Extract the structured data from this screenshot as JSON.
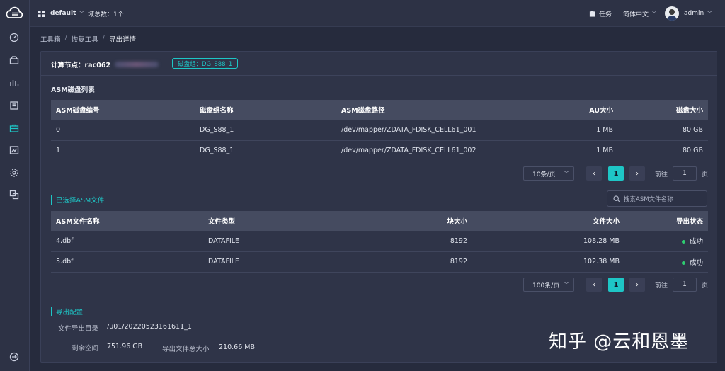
{
  "topbar": {
    "workspace": "default",
    "domain_count": "域总数：1个",
    "tasks": "任务",
    "language": "简体中文",
    "user": "admin"
  },
  "breadcrumb": [
    "工具箱",
    "恢复工具",
    "导出详情"
  ],
  "node": {
    "label": "计算节点：rac062",
    "diskgroup_tag": "磁盘组：DG_S88_1"
  },
  "asm_disks": {
    "title": "ASM磁盘列表",
    "headers": [
      "ASM磁盘编号",
      "磁盘组名称",
      "ASM磁盘路径",
      "AU大小",
      "磁盘大小"
    ],
    "rows": [
      [
        "0",
        "DG_S88_1",
        "/dev/mapper/ZDATA_FDISK_CELL61_001",
        "1 MB",
        "80 GB"
      ],
      [
        "1",
        "DG_S88_1",
        "/dev/mapper/ZDATA_FDISK_CELL61_002",
        "1 MB",
        "80 GB"
      ]
    ],
    "pager": {
      "page_size": "10条/页",
      "page": "1",
      "goto_label": "前往",
      "goto_value": "1",
      "page_unit": "页"
    }
  },
  "asm_files": {
    "title": "已选择ASM文件",
    "search_placeholder": "搜索ASM文件名称",
    "headers": [
      "ASM文件名称",
      "文件类型",
      "块大小",
      "文件大小",
      "导出状态"
    ],
    "rows": [
      [
        "4.dbf",
        "DATAFILE",
        "8192",
        "108.28 MB",
        "成功"
      ],
      [
        "5.dbf",
        "DATAFILE",
        "8192",
        "102.38 MB",
        "成功"
      ]
    ],
    "pager": {
      "page_size": "100条/页",
      "page": "1",
      "goto_label": "前往",
      "goto_value": "1",
      "page_unit": "页"
    }
  },
  "export_config": {
    "title": "导出配置",
    "dir_label": "文件导出目录",
    "dir_value": "/u01/20220523161611_1",
    "free_label": "剩余空间",
    "free_value": "751.96 GB",
    "total_label": "导出文件总大小",
    "total_value": "210.66 MB"
  },
  "watermark": "知乎 @云和恩墨",
  "colors": {
    "accent": "#1ec6c6",
    "success": "#2ecc71",
    "background": "#262b3d",
    "panel": "#2f3448"
  }
}
